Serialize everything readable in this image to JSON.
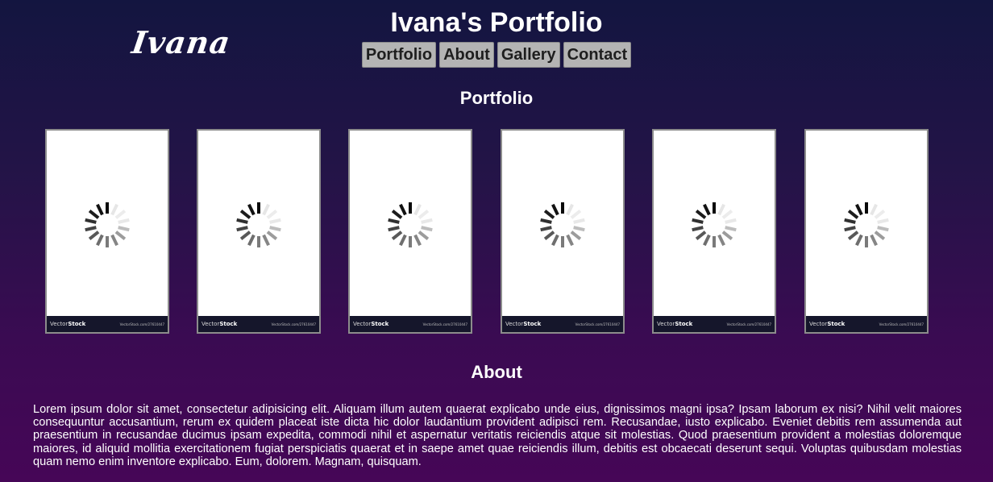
{
  "header": {
    "logo_text": "Ivana",
    "title": "Ivana's Portfolio"
  },
  "nav": {
    "items": [
      {
        "label": "Portfolio"
      },
      {
        "label": "About"
      },
      {
        "label": "Gallery"
      },
      {
        "label": "Contact"
      }
    ]
  },
  "portfolio": {
    "heading": "Portfolio",
    "cards": [
      {
        "brand_light": "Vector",
        "brand_bold": "Stock",
        "url": "VectorStock.com/27610447",
        "icon": "loading-spinner-icon"
      },
      {
        "brand_light": "Vector",
        "brand_bold": "Stock",
        "url": "VectorStock.com/27610447",
        "icon": "loading-spinner-icon"
      },
      {
        "brand_light": "Vector",
        "brand_bold": "Stock",
        "url": "VectorStock.com/27610447",
        "icon": "loading-spinner-icon"
      },
      {
        "brand_light": "Vector",
        "brand_bold": "Stock",
        "url": "VectorStock.com/27610447",
        "icon": "loading-spinner-icon"
      },
      {
        "brand_light": "Vector",
        "brand_bold": "Stock",
        "url": "VectorStock.com/27610447",
        "icon": "loading-spinner-icon"
      },
      {
        "brand_light": "Vector",
        "brand_bold": "Stock",
        "url": "VectorStock.com/27610447",
        "icon": "loading-spinner-icon"
      }
    ]
  },
  "about": {
    "heading": "About",
    "text": "Lorem ipsum dolor sit amet, consectetur adipisicing elit. Aliquam illum autem quaerat explicabo unde eius, dignissimos magni ipsa? Ipsam laborum ex nisi? Nihil velit maiores consequuntur accusantium, rerum ex quidem placeat iste dicta hic dolor laudantium provident adipisci rem. Recusandae, iusto explicabo. Eveniet debitis rem assumenda aut praesentium in recusandae ducimus ipsam expedita, commodi nihil et aspernatur veritatis reiciendis atque sit molestias. Quod praesentium provident a molestias doloremque maiores, id aliquid mollitia exercitationem fugiat perspiciatis quaerat et in saepe amet quae reiciendis illum, debitis est obcaecati deserunt sequi. Voluptas quibusdam molestias quam nemo enim inventore explicabo. Eum, dolorem. Magnam, quisquam."
  },
  "colors": {
    "background_top": "#131540",
    "background_bottom": "#460657",
    "nav_button": "#b4b4b4",
    "card_footer": "#15162b"
  }
}
